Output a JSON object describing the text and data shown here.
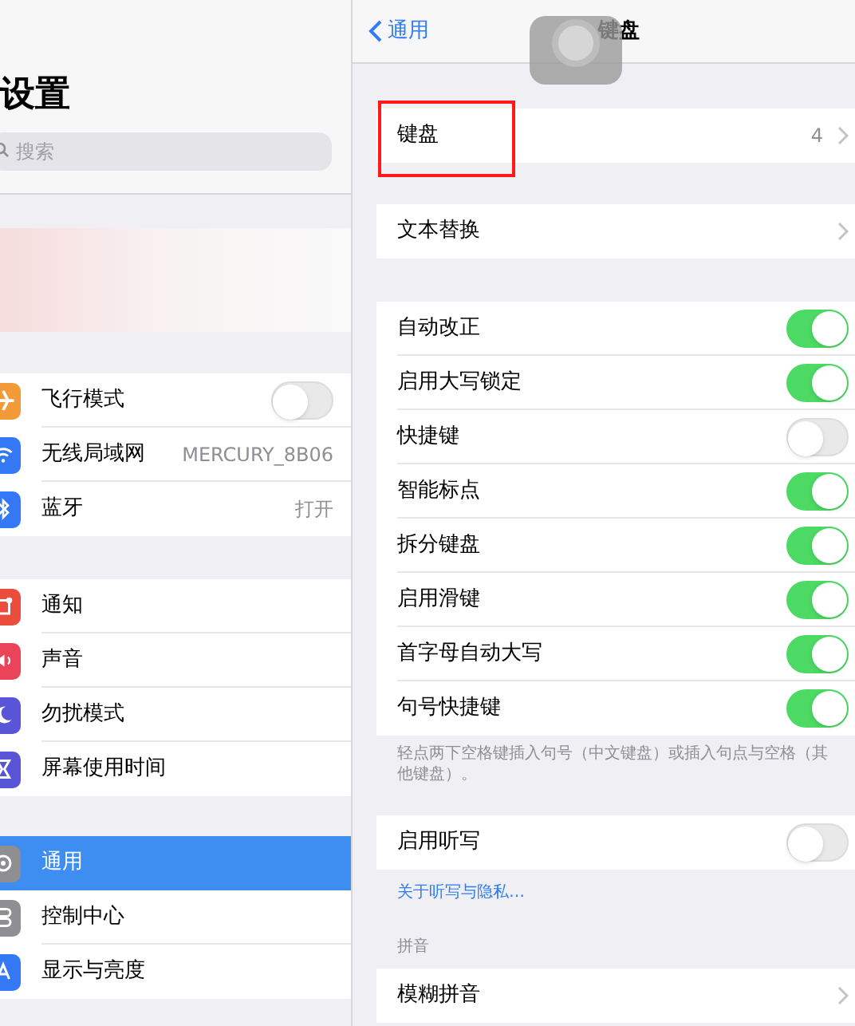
{
  "sidebar": {
    "title": "设置",
    "search": {
      "placeholder": "搜索"
    },
    "groups": [
      [
        {
          "label": "飞行模式",
          "kind": "toggle",
          "on": false,
          "color": "#f19a37",
          "selected": false
        },
        {
          "label": "无线局域网",
          "kind": "value",
          "value": "MERCURY_8B06",
          "color": "#3478f6",
          "selected": false
        },
        {
          "label": "蓝牙",
          "kind": "value",
          "value": "打开",
          "color": "#3478f6",
          "selected": false
        }
      ],
      [
        {
          "label": "通知",
          "kind": "plain",
          "color": "#eb4d3d",
          "selected": false
        },
        {
          "label": "声音",
          "kind": "plain",
          "color": "#eb445a",
          "selected": false
        },
        {
          "label": "勿扰模式",
          "kind": "plain",
          "color": "#5856d6",
          "selected": false
        },
        {
          "label": "屏幕使用时间",
          "kind": "plain",
          "color": "#5856d6",
          "selected": false
        }
      ],
      [
        {
          "label": "通用",
          "kind": "plain",
          "color": "#8e8e93",
          "selected": true
        },
        {
          "label": "控制中心",
          "kind": "plain",
          "color": "#8e8e93",
          "selected": false
        },
        {
          "label": "显示与亮度",
          "kind": "plain",
          "color": "#3478f6",
          "selected": false
        }
      ]
    ]
  },
  "nav": {
    "back": "通用",
    "title": "键盘"
  },
  "sections": [
    {
      "rows": [
        {
          "label": "键盘",
          "kind": "link",
          "value": "4",
          "highlighted": true
        }
      ]
    },
    {
      "rows": [
        {
          "label": "文本替换",
          "kind": "link",
          "highlighted": false
        }
      ]
    },
    {
      "rows": [
        {
          "label": "自动改正",
          "kind": "toggle",
          "on": true
        },
        {
          "label": "启用大写锁定",
          "kind": "toggle",
          "on": true
        },
        {
          "label": "快捷键",
          "kind": "toggle",
          "on": false
        },
        {
          "label": "智能标点",
          "kind": "toggle",
          "on": true
        },
        {
          "label": "拆分键盘",
          "kind": "toggle",
          "on": true
        },
        {
          "label": "启用滑键",
          "kind": "toggle",
          "on": true
        },
        {
          "label": "首字母自动大写",
          "kind": "toggle",
          "on": true
        },
        {
          "label": "句号快捷键",
          "kind": "toggle",
          "on": true
        }
      ],
      "footer": "轻点两下空格键插入句号（中文键盘）或插入句点与空格（其他键盘）。"
    },
    {
      "rows": [
        {
          "label": "启用听写",
          "kind": "toggle",
          "on": false
        }
      ],
      "footer_link": "关于听写与隐私…"
    },
    {
      "header": "拼音",
      "rows": [
        {
          "label": "模糊拼音",
          "kind": "link",
          "highlighted": false
        }
      ]
    }
  ]
}
